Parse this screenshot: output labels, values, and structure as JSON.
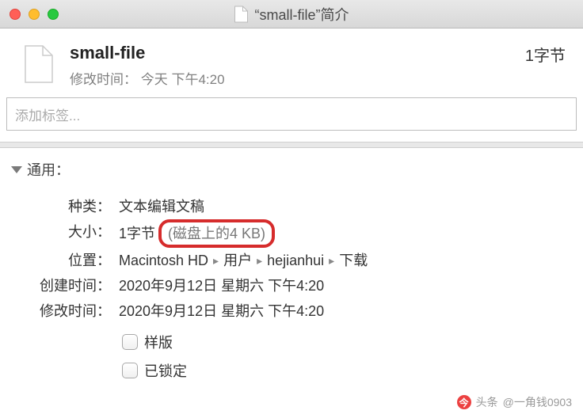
{
  "window": {
    "title": "“small-file”简介"
  },
  "header": {
    "filename": "small-file",
    "size_summary": "1字节",
    "modified_label": "修改时间：",
    "modified_value": "今天 下午4:20"
  },
  "tags": {
    "placeholder": "添加标签..."
  },
  "general": {
    "section_title": "通用：",
    "kind_label": "种类：",
    "kind_value": "文本编辑文稿",
    "size_label": "大小：",
    "size_value": "1字节",
    "size_on_disk": "(磁盘上的4 KB)",
    "where_label": "位置：",
    "path": [
      "Macintosh HD",
      "用户",
      "hejianhui",
      "下载"
    ],
    "created_label": "创建时间：",
    "created_value": "2020年9月12日 星期六 下午4:20",
    "modified_label": "修改时间：",
    "modified_value": "2020年9月12日 星期六 下午4:20",
    "stationery_label": "样版",
    "locked_label": "已锁定"
  },
  "watermark": {
    "prefix": "头条",
    "author": "@一角钱0903"
  }
}
